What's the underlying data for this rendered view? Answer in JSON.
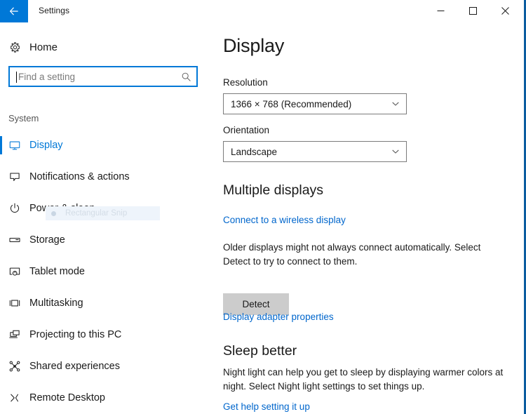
{
  "window": {
    "title": "Settings",
    "accent_color": "#0078d7",
    "border_color": "#0a5ca0",
    "back_icon": "back-arrow-icon",
    "controls": {
      "minimize": "minimize-icon",
      "maximize": "maximize-icon",
      "close": "close-icon"
    }
  },
  "sidebar": {
    "home": {
      "label": "Home",
      "icon": "gear-icon"
    },
    "search": {
      "value": "",
      "placeholder": "Find a setting",
      "icon": "search-icon"
    },
    "group_label": "System",
    "items": [
      {
        "label": "Display",
        "icon": "monitor-icon",
        "selected": true
      },
      {
        "label": "Notifications & actions",
        "icon": "notification-balloon-icon",
        "selected": false
      },
      {
        "label": "Power & sleep",
        "icon": "power-icon",
        "selected": false
      },
      {
        "label": "Storage",
        "icon": "storage-drive-icon",
        "selected": false
      },
      {
        "label": "Tablet mode",
        "icon": "tablet-mode-icon",
        "selected": false
      },
      {
        "label": "Multitasking",
        "icon": "multitasking-icon",
        "selected": false
      },
      {
        "label": "Projecting to this PC",
        "icon": "projecting-icon",
        "selected": false
      },
      {
        "label": "Shared experiences",
        "icon": "shared-experiences-icon",
        "selected": false
      },
      {
        "label": "Remote Desktop",
        "icon": "remote-desktop-icon",
        "selected": false
      }
    ],
    "ghost_overlay": {
      "label": "Rectangular Snip",
      "icon": "bullet-dot-icon"
    }
  },
  "main": {
    "page_title": "Display",
    "resolution": {
      "label": "Resolution",
      "value": "1366 × 768 (Recommended)",
      "arrow_icon": "chevron-down-icon"
    },
    "orientation": {
      "label": "Orientation",
      "value": "Landscape",
      "arrow_icon": "chevron-down-icon"
    },
    "multiple_displays": {
      "heading": "Multiple displays",
      "wireless_link": "Connect to a wireless display",
      "description": "Older displays might not always connect automatically. Select Detect to try to connect to them.",
      "detect_button": "Detect",
      "adapter_link": "Display adapter properties"
    },
    "sleep_better": {
      "heading": "Sleep better",
      "description": "Night light can help you get to sleep by displaying warmer colors at night. Select Night light settings to set things up.",
      "help_link": "Get help setting it up"
    }
  }
}
